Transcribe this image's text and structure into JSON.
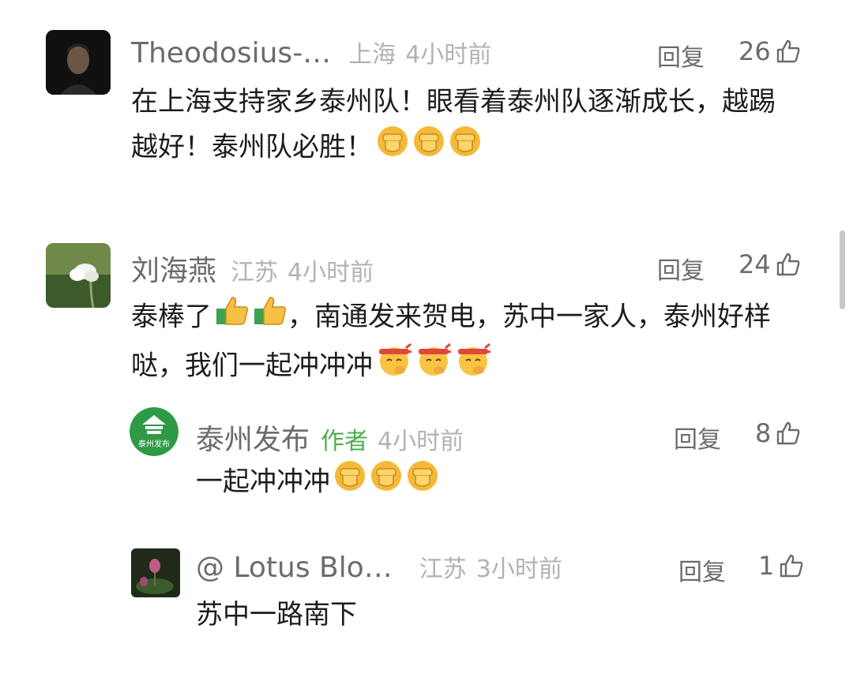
{
  "comments": [
    {
      "name": "Theodosius-…",
      "location": "上海",
      "time": "4小时前",
      "reply_label": "回复",
      "likes": "26",
      "text": "在上海支持家乡泰州队！眼看着泰州队逐渐成长，越踢越好！泰州队必胜！",
      "emoji": [
        "fist-emoji",
        "fist-emoji",
        "fist-emoji"
      ]
    },
    {
      "name": "刘海燕",
      "location": "江苏",
      "time": "4小时前",
      "reply_label": "回复",
      "likes": "24",
      "text_part1": "泰棒了",
      "text_part2": "，南通发来贺电，苏中一家人，泰州好样哒，我们一起冲冲冲",
      "emoji_mid": [
        "thumbs-up-emoji",
        "thumbs-up-emoji"
      ],
      "emoji_end": [
        "headband-face-emoji",
        "headband-face-emoji",
        "headband-face-emoji"
      ],
      "replies": [
        {
          "name": "泰州发布",
          "author_tag": "作者",
          "time": "4小时前",
          "reply_label": "回复",
          "likes": "8",
          "text": "一起冲冲冲",
          "avatar_text": "泰州发布",
          "emoji": [
            "fist-emoji",
            "fist-emoji",
            "fist-emoji"
          ]
        },
        {
          "name": "@ Lotus Blo…",
          "location": "江苏",
          "time": "3小时前",
          "reply_label": "回复",
          "likes": "1",
          "text": "苏中一路南下"
        }
      ]
    }
  ],
  "colors": {
    "name": "#6b6b6b",
    "meta": "#b2b2b2",
    "author_tag": "#4caf50",
    "text": "#1c1c1c"
  }
}
